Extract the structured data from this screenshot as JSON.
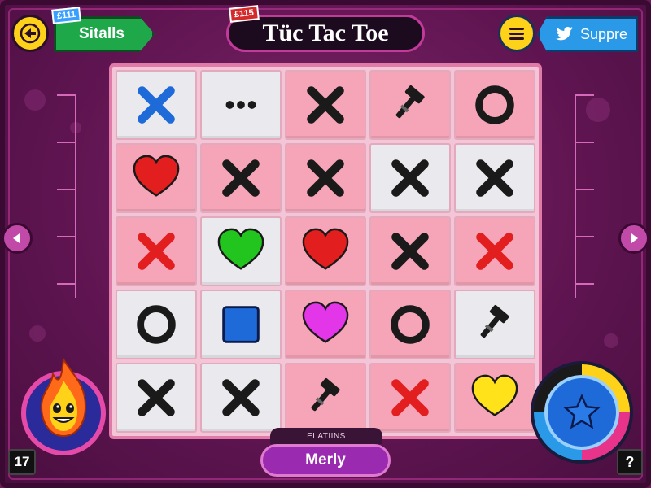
{
  "header": {
    "stats_tag": "£1​11",
    "stats_label": "Sitalls",
    "title_tag": "£115",
    "title": "Tüc Tac Toe",
    "share_label": "Suppre",
    "menu_icon": "hamburger-icon",
    "back_icon": "back-arrow-icon",
    "share_icon": "bird-icon"
  },
  "board": {
    "rows": [
      [
        {
          "bg": "white",
          "piece": "x-blue"
        },
        {
          "bg": "white",
          "piece": "dots"
        },
        {
          "bg": "pink",
          "piece": "x-black"
        },
        {
          "bg": "pink",
          "piece": "hammer"
        },
        {
          "bg": "pink",
          "piece": "o-black"
        }
      ],
      [
        {
          "bg": "pink",
          "piece": "heart-red"
        },
        {
          "bg": "pink",
          "piece": "x-black"
        },
        {
          "bg": "pink",
          "piece": "x-black"
        },
        {
          "bg": "white",
          "piece": "x-black"
        },
        {
          "bg": "white",
          "piece": "x-black"
        }
      ],
      [
        {
          "bg": "pink",
          "piece": "x-red"
        },
        {
          "bg": "white",
          "piece": "heart-green"
        },
        {
          "bg": "pink",
          "piece": "heart-red"
        },
        {
          "bg": "pink",
          "piece": "x-black"
        },
        {
          "bg": "pink",
          "piece": "x-red"
        }
      ],
      [
        {
          "bg": "white",
          "piece": "o-black"
        },
        {
          "bg": "white",
          "piece": "square-blue"
        },
        {
          "bg": "pink",
          "piece": "heart-magenta"
        },
        {
          "bg": "pink",
          "piece": "o-black"
        },
        {
          "bg": "white",
          "piece": "hammer"
        }
      ],
      [
        {
          "bg": "white",
          "piece": "x-black"
        },
        {
          "bg": "white",
          "piece": "x-black"
        },
        {
          "bg": "pink",
          "piece": "hammer"
        },
        {
          "bg": "pink",
          "piece": "x-red"
        },
        {
          "bg": "pink",
          "piece": "heart-yellow"
        }
      ]
    ]
  },
  "footer": {
    "counter": "17",
    "help": "?",
    "status_label": "ELATIINS",
    "player_name": "Merly"
  },
  "colors": {
    "x_blue": "#1e6ad8",
    "x_black": "#1a1a1a",
    "x_red": "#e21e1e",
    "heart_red": "#e21e1e",
    "heart_green": "#22c41e",
    "heart_magenta": "#e236e8",
    "heart_yellow": "#ffe21a",
    "square_blue": "#1e6ad8"
  }
}
